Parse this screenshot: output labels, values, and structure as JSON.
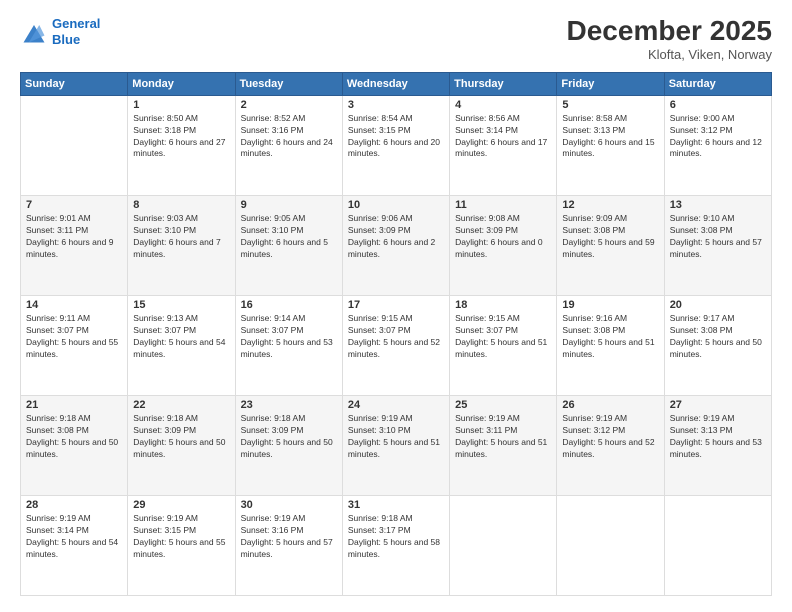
{
  "header": {
    "logo_line1": "General",
    "logo_line2": "Blue",
    "month_title": "December 2025",
    "location": "Klofta, Viken, Norway"
  },
  "weekdays": [
    "Sunday",
    "Monday",
    "Tuesday",
    "Wednesday",
    "Thursday",
    "Friday",
    "Saturday"
  ],
  "weeks": [
    [
      {
        "day": "",
        "sunrise": "",
        "sunset": "",
        "daylight": ""
      },
      {
        "day": "1",
        "sunrise": "Sunrise: 8:50 AM",
        "sunset": "Sunset: 3:18 PM",
        "daylight": "Daylight: 6 hours and 27 minutes."
      },
      {
        "day": "2",
        "sunrise": "Sunrise: 8:52 AM",
        "sunset": "Sunset: 3:16 PM",
        "daylight": "Daylight: 6 hours and 24 minutes."
      },
      {
        "day": "3",
        "sunrise": "Sunrise: 8:54 AM",
        "sunset": "Sunset: 3:15 PM",
        "daylight": "Daylight: 6 hours and 20 minutes."
      },
      {
        "day": "4",
        "sunrise": "Sunrise: 8:56 AM",
        "sunset": "Sunset: 3:14 PM",
        "daylight": "Daylight: 6 hours and 17 minutes."
      },
      {
        "day": "5",
        "sunrise": "Sunrise: 8:58 AM",
        "sunset": "Sunset: 3:13 PM",
        "daylight": "Daylight: 6 hours and 15 minutes."
      },
      {
        "day": "6",
        "sunrise": "Sunrise: 9:00 AM",
        "sunset": "Sunset: 3:12 PM",
        "daylight": "Daylight: 6 hours and 12 minutes."
      }
    ],
    [
      {
        "day": "7",
        "sunrise": "Sunrise: 9:01 AM",
        "sunset": "Sunset: 3:11 PM",
        "daylight": "Daylight: 6 hours and 9 minutes."
      },
      {
        "day": "8",
        "sunrise": "Sunrise: 9:03 AM",
        "sunset": "Sunset: 3:10 PM",
        "daylight": "Daylight: 6 hours and 7 minutes."
      },
      {
        "day": "9",
        "sunrise": "Sunrise: 9:05 AM",
        "sunset": "Sunset: 3:10 PM",
        "daylight": "Daylight: 6 hours and 5 minutes."
      },
      {
        "day": "10",
        "sunrise": "Sunrise: 9:06 AM",
        "sunset": "Sunset: 3:09 PM",
        "daylight": "Daylight: 6 hours and 2 minutes."
      },
      {
        "day": "11",
        "sunrise": "Sunrise: 9:08 AM",
        "sunset": "Sunset: 3:09 PM",
        "daylight": "Daylight: 6 hours and 0 minutes."
      },
      {
        "day": "12",
        "sunrise": "Sunrise: 9:09 AM",
        "sunset": "Sunset: 3:08 PM",
        "daylight": "Daylight: 5 hours and 59 minutes."
      },
      {
        "day": "13",
        "sunrise": "Sunrise: 9:10 AM",
        "sunset": "Sunset: 3:08 PM",
        "daylight": "Daylight: 5 hours and 57 minutes."
      }
    ],
    [
      {
        "day": "14",
        "sunrise": "Sunrise: 9:11 AM",
        "sunset": "Sunset: 3:07 PM",
        "daylight": "Daylight: 5 hours and 55 minutes."
      },
      {
        "day": "15",
        "sunrise": "Sunrise: 9:13 AM",
        "sunset": "Sunset: 3:07 PM",
        "daylight": "Daylight: 5 hours and 54 minutes."
      },
      {
        "day": "16",
        "sunrise": "Sunrise: 9:14 AM",
        "sunset": "Sunset: 3:07 PM",
        "daylight": "Daylight: 5 hours and 53 minutes."
      },
      {
        "day": "17",
        "sunrise": "Sunrise: 9:15 AM",
        "sunset": "Sunset: 3:07 PM",
        "daylight": "Daylight: 5 hours and 52 minutes."
      },
      {
        "day": "18",
        "sunrise": "Sunrise: 9:15 AM",
        "sunset": "Sunset: 3:07 PM",
        "daylight": "Daylight: 5 hours and 51 minutes."
      },
      {
        "day": "19",
        "sunrise": "Sunrise: 9:16 AM",
        "sunset": "Sunset: 3:08 PM",
        "daylight": "Daylight: 5 hours and 51 minutes."
      },
      {
        "day": "20",
        "sunrise": "Sunrise: 9:17 AM",
        "sunset": "Sunset: 3:08 PM",
        "daylight": "Daylight: 5 hours and 50 minutes."
      }
    ],
    [
      {
        "day": "21",
        "sunrise": "Sunrise: 9:18 AM",
        "sunset": "Sunset: 3:08 PM",
        "daylight": "Daylight: 5 hours and 50 minutes."
      },
      {
        "day": "22",
        "sunrise": "Sunrise: 9:18 AM",
        "sunset": "Sunset: 3:09 PM",
        "daylight": "Daylight: 5 hours and 50 minutes."
      },
      {
        "day": "23",
        "sunrise": "Sunrise: 9:18 AM",
        "sunset": "Sunset: 3:09 PM",
        "daylight": "Daylight: 5 hours and 50 minutes."
      },
      {
        "day": "24",
        "sunrise": "Sunrise: 9:19 AM",
        "sunset": "Sunset: 3:10 PM",
        "daylight": "Daylight: 5 hours and 51 minutes."
      },
      {
        "day": "25",
        "sunrise": "Sunrise: 9:19 AM",
        "sunset": "Sunset: 3:11 PM",
        "daylight": "Daylight: 5 hours and 51 minutes."
      },
      {
        "day": "26",
        "sunrise": "Sunrise: 9:19 AM",
        "sunset": "Sunset: 3:12 PM",
        "daylight": "Daylight: 5 hours and 52 minutes."
      },
      {
        "day": "27",
        "sunrise": "Sunrise: 9:19 AM",
        "sunset": "Sunset: 3:13 PM",
        "daylight": "Daylight: 5 hours and 53 minutes."
      }
    ],
    [
      {
        "day": "28",
        "sunrise": "Sunrise: 9:19 AM",
        "sunset": "Sunset: 3:14 PM",
        "daylight": "Daylight: 5 hours and 54 minutes."
      },
      {
        "day": "29",
        "sunrise": "Sunrise: 9:19 AM",
        "sunset": "Sunset: 3:15 PM",
        "daylight": "Daylight: 5 hours and 55 minutes."
      },
      {
        "day": "30",
        "sunrise": "Sunrise: 9:19 AM",
        "sunset": "Sunset: 3:16 PM",
        "daylight": "Daylight: 5 hours and 57 minutes."
      },
      {
        "day": "31",
        "sunrise": "Sunrise: 9:18 AM",
        "sunset": "Sunset: 3:17 PM",
        "daylight": "Daylight: 5 hours and 58 minutes."
      },
      {
        "day": "",
        "sunrise": "",
        "sunset": "",
        "daylight": ""
      },
      {
        "day": "",
        "sunrise": "",
        "sunset": "",
        "daylight": ""
      },
      {
        "day": "",
        "sunrise": "",
        "sunset": "",
        "daylight": ""
      }
    ]
  ]
}
